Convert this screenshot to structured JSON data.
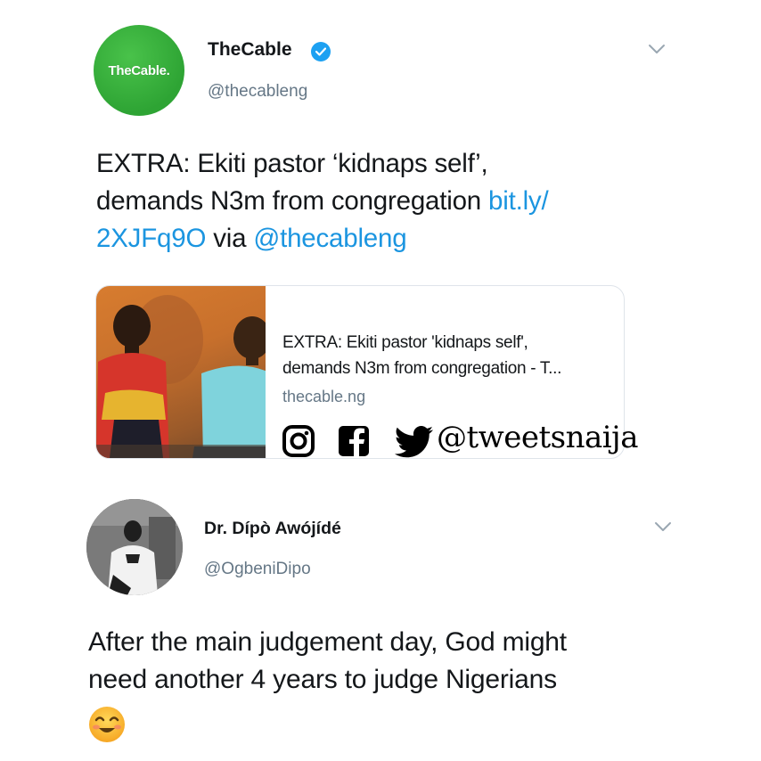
{
  "tweets": [
    {
      "avatar_text": "TheCable.",
      "name": "TheCable",
      "handle": "@thecableng",
      "text_line1": "EXTRA: Ekiti pastor ‘kidnaps self’,",
      "text_line2_plain": "demands N3m from congregation ",
      "text_line2_link": "bit.ly/",
      "text_line3_link": "2XJFq9O",
      "text_line3_plain": " via ",
      "text_line3_mention": "@thecableng",
      "card": {
        "title_line1": "EXTRA: Ekiti pastor 'kidnaps self',",
        "title_line2": "demands N3m from congregation - T...",
        "domain": "thecable.ng"
      }
    },
    {
      "name": "Dr. Dípò Awójídé",
      "handle": "@OgbeniDipo",
      "text_line1": "After the main judgement day, God might",
      "text_line2": "need another 4 years to judge Nigerians"
    }
  ],
  "watermark": {
    "handle": "@tweetsnaija",
    "icons": [
      "instagram-icon",
      "facebook-icon",
      "twitter-icon"
    ]
  },
  "colors": {
    "link": "#1b95e0",
    "verified": "#1da1f2",
    "secondary_text": "#657786",
    "avatar_green": "#2ea434"
  }
}
